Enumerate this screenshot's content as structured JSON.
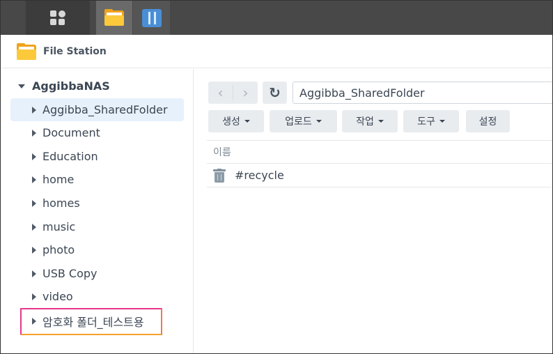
{
  "app": {
    "title": "File Station"
  },
  "taskbar": {
    "items": [
      {
        "name": "main-menu",
        "icon": "grid-icon"
      },
      {
        "name": "file-station",
        "icon": "folder-icon",
        "active": true
      },
      {
        "name": "control-panel",
        "icon": "control-panel-icon"
      }
    ]
  },
  "sidebar": {
    "root_label": "AggibbaNAS",
    "items": [
      {
        "label": "Aggibba_SharedFolder",
        "selected": true
      },
      {
        "label": "Document"
      },
      {
        "label": "Education"
      },
      {
        "label": "home"
      },
      {
        "label": "homes"
      },
      {
        "label": "music"
      },
      {
        "label": "photo"
      },
      {
        "label": "USB Copy"
      },
      {
        "label": "video"
      },
      {
        "label": "암호화 폴더_테스트용",
        "highlighted": true
      }
    ]
  },
  "toolbar": {
    "back_icon": "chevron-left-icon",
    "forward_icon": "chevron-right-icon",
    "refresh_icon": "refresh-icon",
    "path": "Aggibba_SharedFolder",
    "buttons": [
      {
        "label": "생성",
        "dropdown": true
      },
      {
        "label": "업로드",
        "dropdown": true
      },
      {
        "label": "작업",
        "dropdown": true
      },
      {
        "label": "도구",
        "dropdown": true
      },
      {
        "label": "설정",
        "dropdown": false
      }
    ]
  },
  "file_list": {
    "column_name": "이름",
    "rows": [
      {
        "name": "#recycle",
        "icon": "trash-icon"
      }
    ]
  },
  "colors": {
    "highlight_border": "#e8368a",
    "highlight_border_bottom": "#f6a12a",
    "selected_bg": "#e7f1fc",
    "folder": "#fcc93a"
  }
}
